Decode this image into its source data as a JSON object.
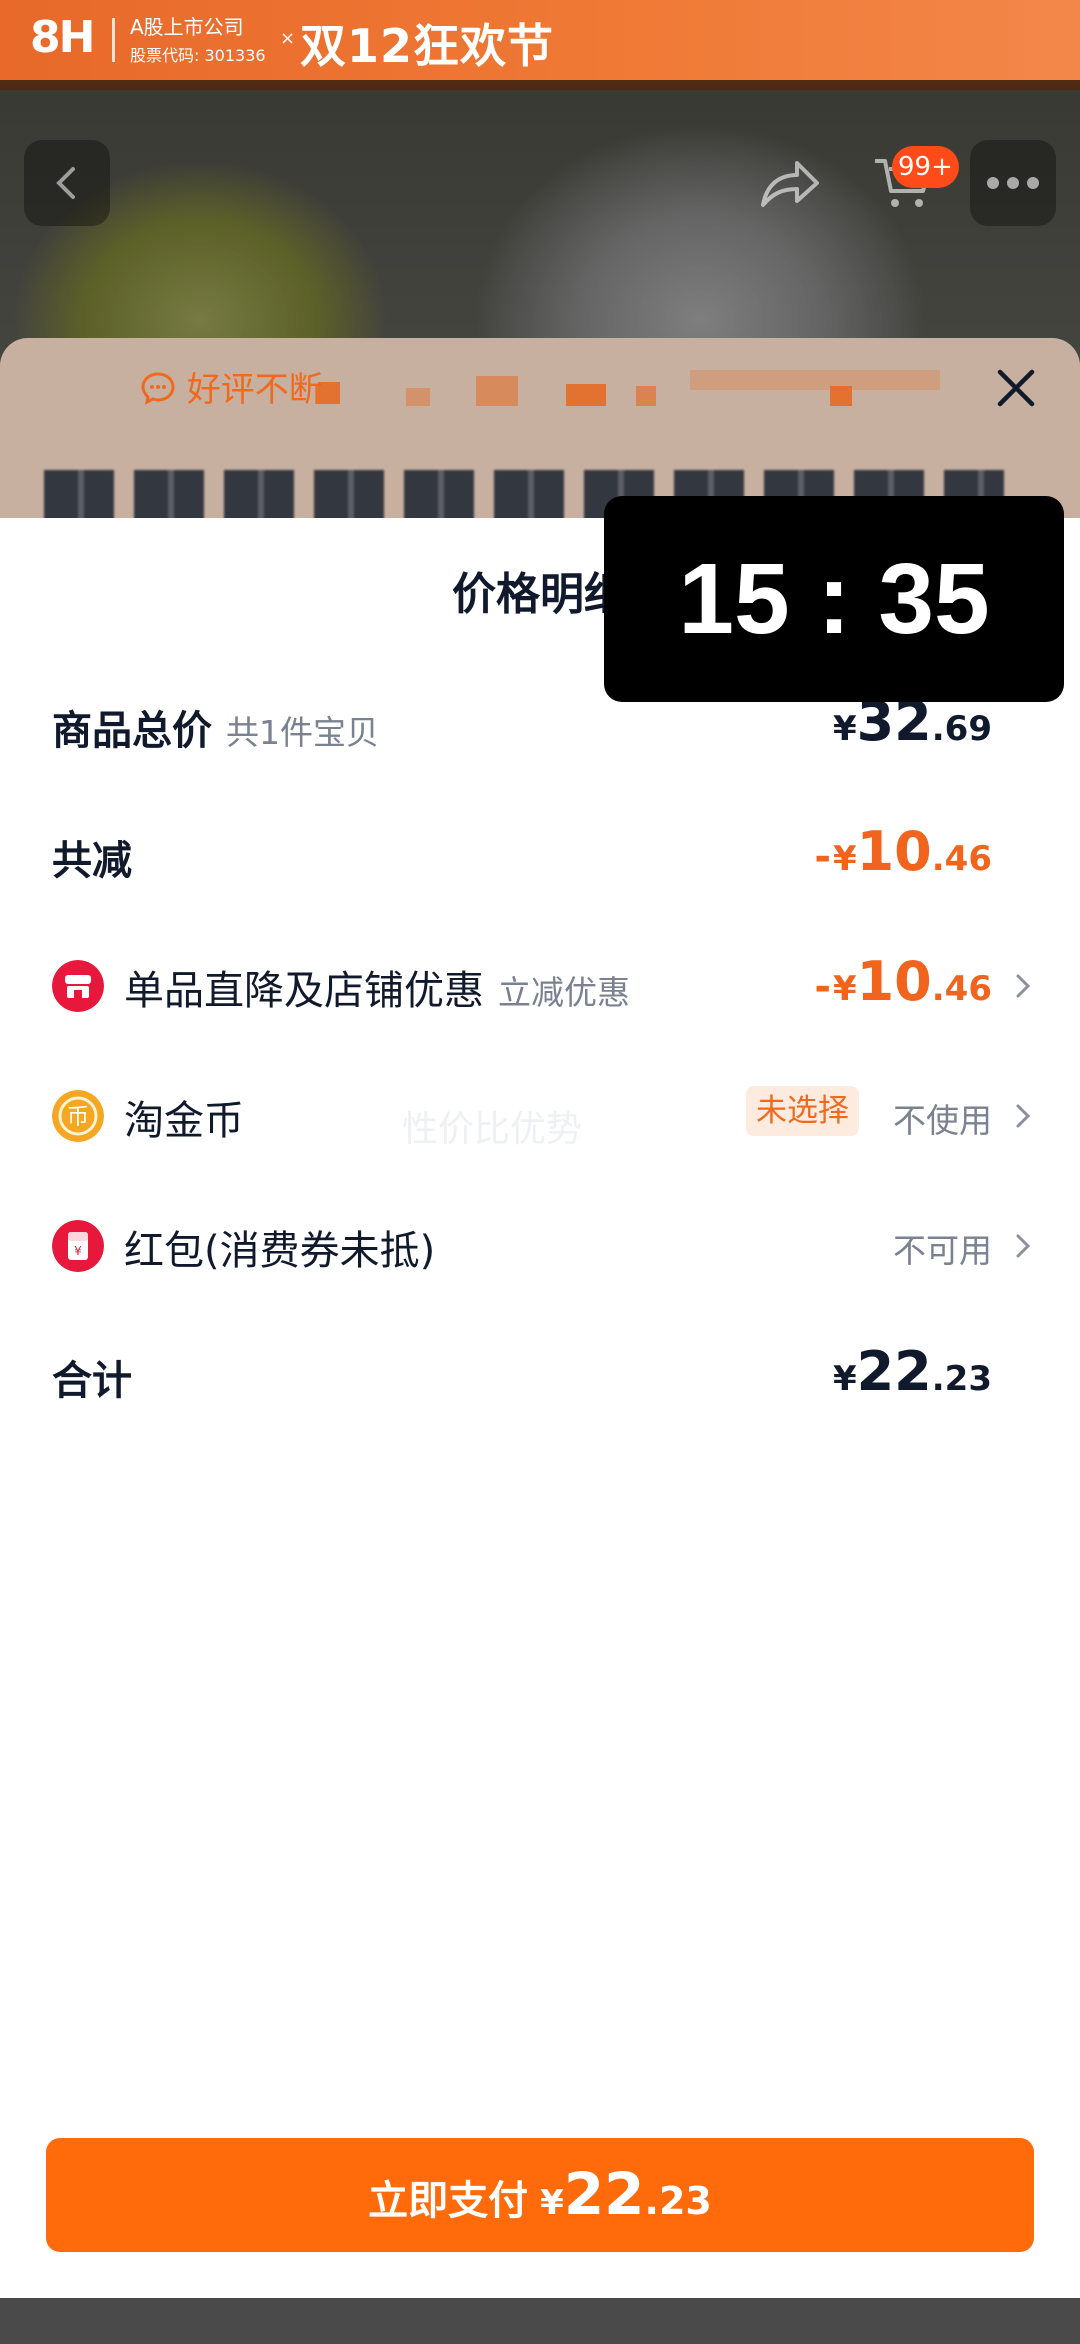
{
  "banner": {
    "logo": "8H",
    "company": "A股上市公司",
    "stock_code": "股票代码: 301336",
    "x": "×",
    "festival": "双12狂欢节"
  },
  "top_bar": {
    "cart_badge": "99+"
  },
  "sheet": {
    "review_text": "好评不断"
  },
  "price_detail": {
    "title": "价格明细",
    "total": {
      "label": "商品总价",
      "sub": "共1件宝贝",
      "yen": "¥",
      "int": "32",
      "dec": ".69"
    },
    "reduction": {
      "label": "共减",
      "minus": "-",
      "yen": "¥",
      "int": "10",
      "dec": ".46"
    },
    "store_discount": {
      "label": "单品直降及店铺优惠",
      "sub": "立减优惠",
      "minus": "-",
      "yen": "¥",
      "int": "10",
      "dec": ".46",
      "icon": "store-icon",
      "icon_color": "#e8173c"
    },
    "coins": {
      "label": "淘金币",
      "tag": "未选择",
      "value": "不使用",
      "icon": "coin-icon",
      "icon_color": "#f5a623"
    },
    "red_packet": {
      "label": "红包(消费券未抵)",
      "value": "不可用",
      "icon": "red-packet-icon",
      "icon_color": "#e8173c"
    },
    "sum": {
      "label": "合计",
      "yen": "¥",
      "int": "22",
      "dec": ".23"
    },
    "watermark": "性价比优势"
  },
  "timer": {
    "text": "15 : 35"
  },
  "pay_button": {
    "label": "立即支付",
    "yen": "¥",
    "int": "22",
    "dec": ".23",
    "color": "#ff6a0a"
  },
  "colors": {
    "accent_orange": "#f0641e",
    "text_dark": "#11192d",
    "text_gray": "#7a8190"
  }
}
